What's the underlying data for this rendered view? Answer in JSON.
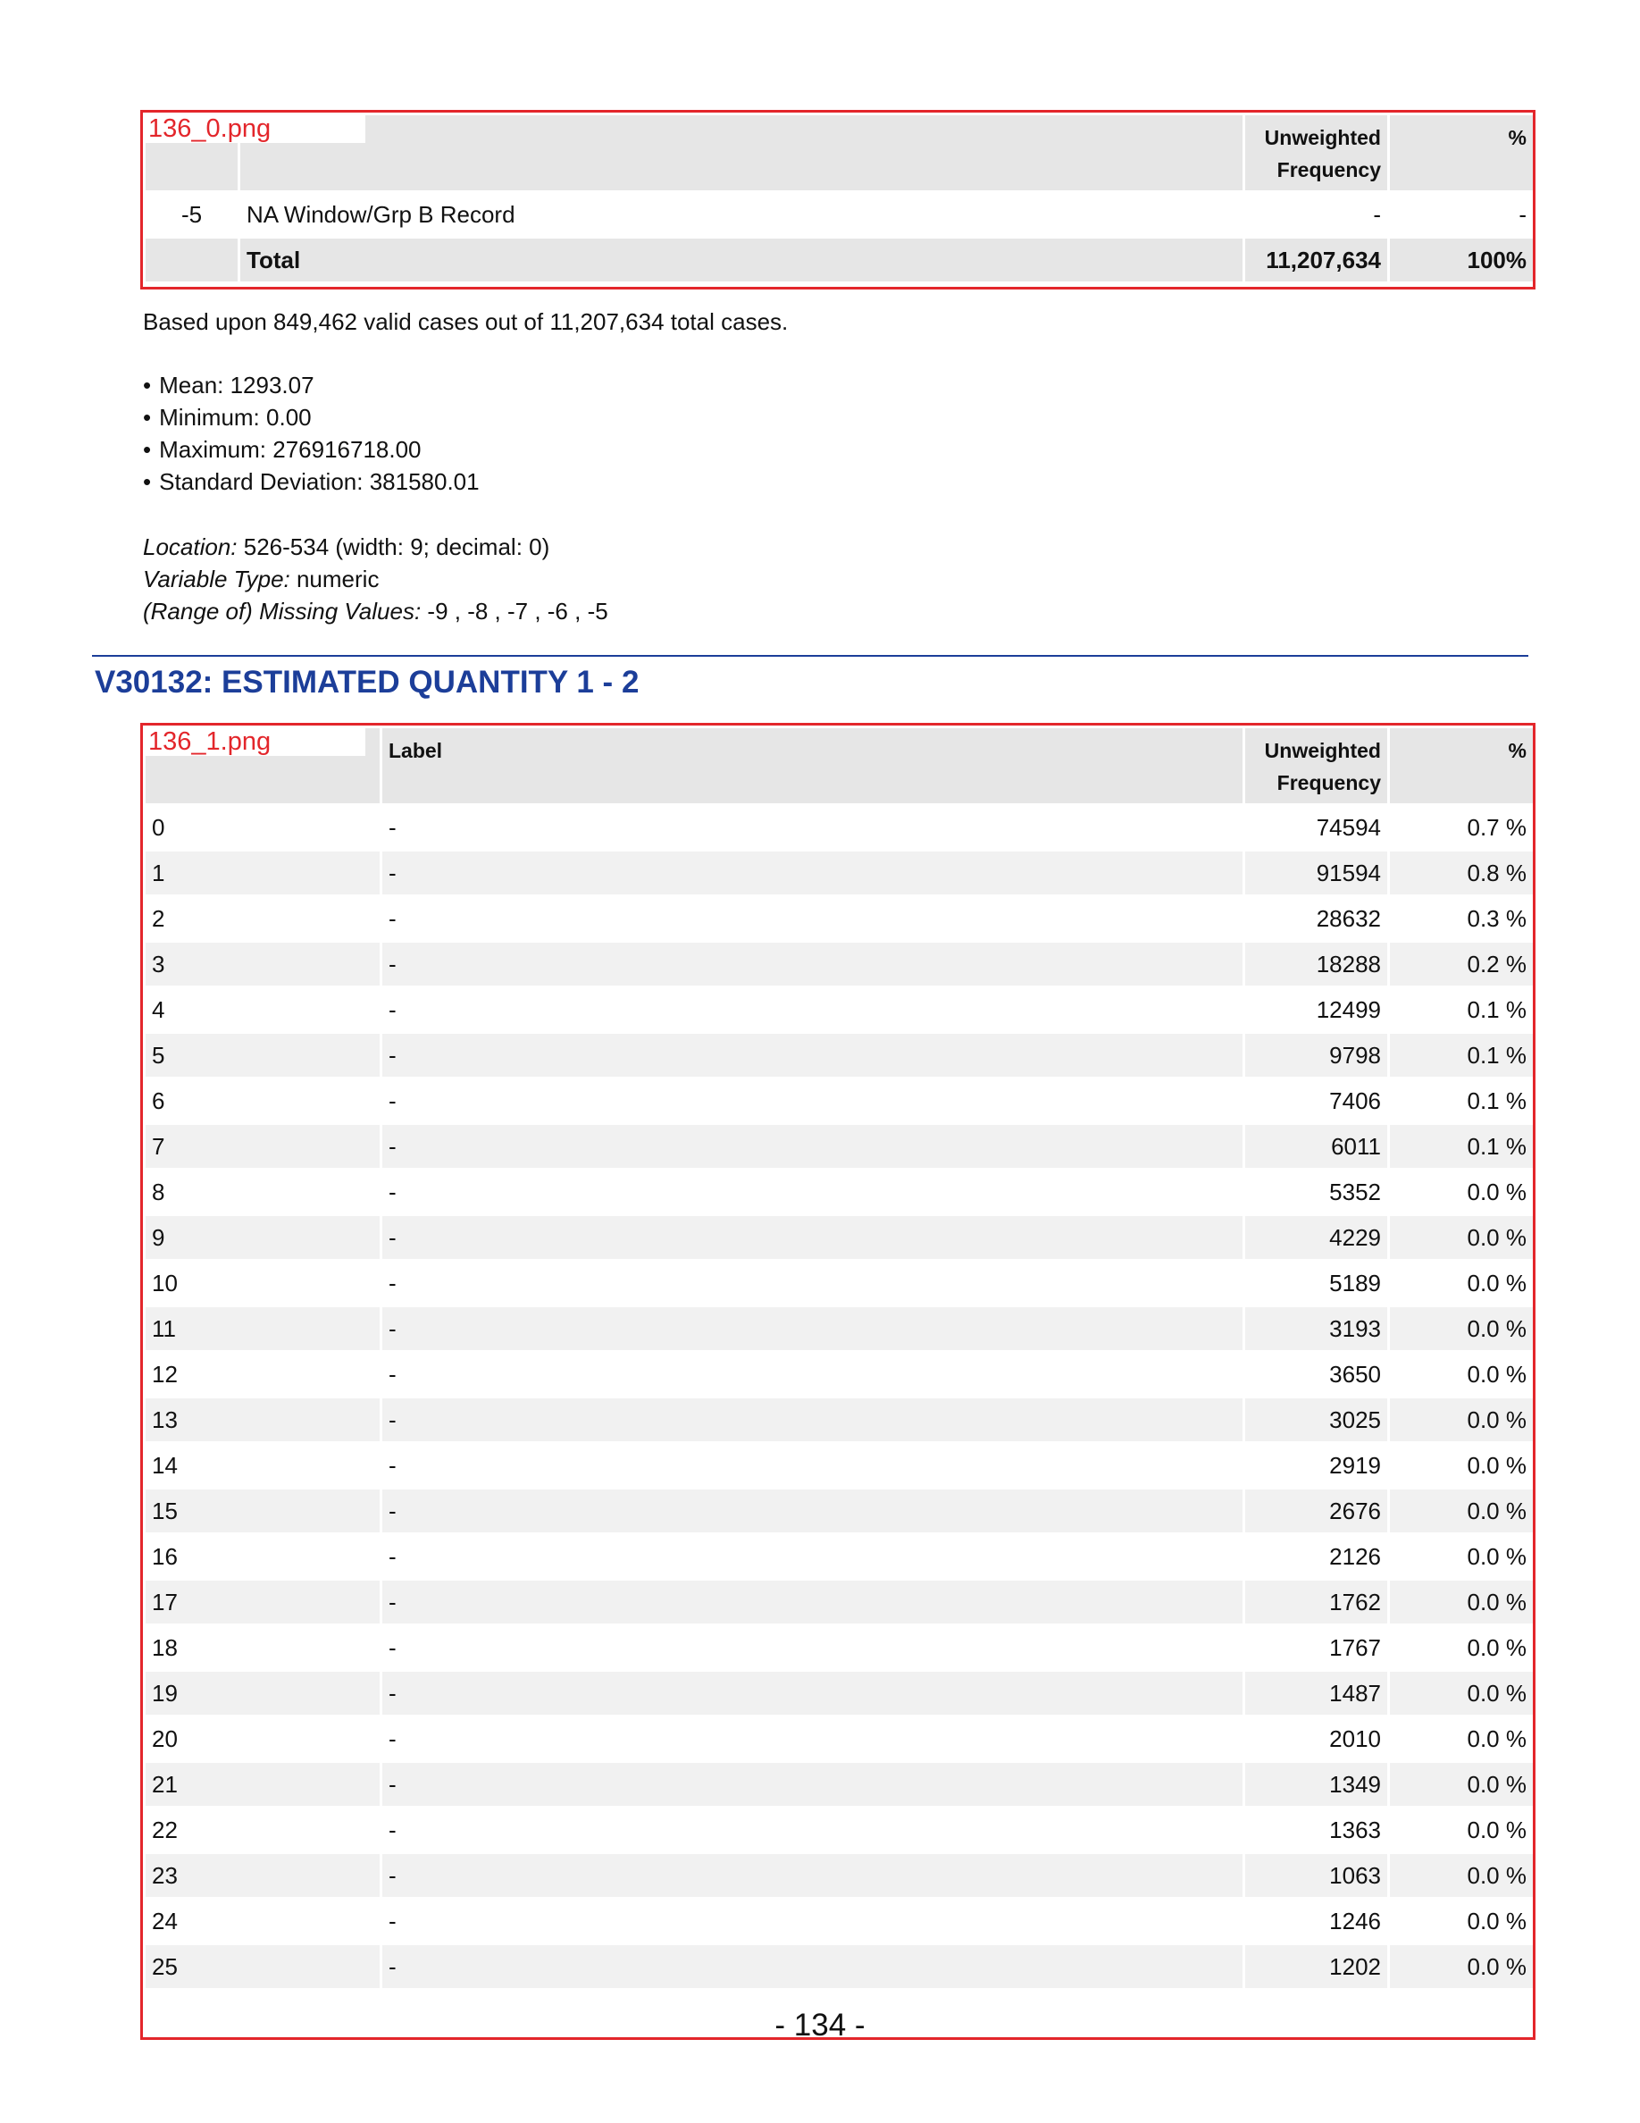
{
  "table1": {
    "tag": "136_0.png",
    "headers": {
      "col1": "",
      "col2": "",
      "freq": "Unweighted Frequency",
      "pct": "%"
    },
    "rows": [
      {
        "code": "-5",
        "label": "NA Window/Grp B Record",
        "freq": "-",
        "pct": "-"
      }
    ],
    "total": {
      "label": "Total",
      "freq": "11,207,634",
      "pct": "100%"
    }
  },
  "summary": {
    "based_on": "Based upon 849,462 valid cases out of 11,207,634 total cases.",
    "stats": [
      "Mean: 1293.07",
      "Minimum: 0.00",
      "Maximum: 276916718.00",
      "Standard Deviation: 381580.01"
    ],
    "location_label": "Location:",
    "location_value": " 526-534 (width: 9; decimal: 0)",
    "vartype_label": "Variable Type:",
    "vartype_value": " numeric",
    "missing_label": "(Range of) Missing Values:",
    "missing_value": " -9 , -8 , -7 , -6 , -5"
  },
  "section": {
    "title": "V30132: ESTIMATED QUANTITY 1 - 2",
    "rule_color": "#1c3e99"
  },
  "table2": {
    "tag": "136_1.png",
    "headers": {
      "value": "",
      "label": "Label",
      "freq": "Unweighted Frequency",
      "pct": "%"
    },
    "rows": [
      {
        "value": "0",
        "label": "-",
        "freq": "74594",
        "pct": "0.7 %"
      },
      {
        "value": "1",
        "label": "-",
        "freq": "91594",
        "pct": "0.8 %"
      },
      {
        "value": "2",
        "label": "-",
        "freq": "28632",
        "pct": "0.3 %"
      },
      {
        "value": "3",
        "label": "-",
        "freq": "18288",
        "pct": "0.2 %"
      },
      {
        "value": "4",
        "label": "-",
        "freq": "12499",
        "pct": "0.1 %"
      },
      {
        "value": "5",
        "label": "-",
        "freq": "9798",
        "pct": "0.1 %"
      },
      {
        "value": "6",
        "label": "-",
        "freq": "7406",
        "pct": "0.1 %"
      },
      {
        "value": "7",
        "label": "-",
        "freq": "6011",
        "pct": "0.1 %"
      },
      {
        "value": "8",
        "label": "-",
        "freq": "5352",
        "pct": "0.0 %"
      },
      {
        "value": "9",
        "label": "-",
        "freq": "4229",
        "pct": "0.0 %"
      },
      {
        "value": "10",
        "label": "-",
        "freq": "5189",
        "pct": "0.0 %"
      },
      {
        "value": "11",
        "label": "-",
        "freq": "3193",
        "pct": "0.0 %"
      },
      {
        "value": "12",
        "label": "-",
        "freq": "3650",
        "pct": "0.0 %"
      },
      {
        "value": "13",
        "label": "-",
        "freq": "3025",
        "pct": "0.0 %"
      },
      {
        "value": "14",
        "label": "-",
        "freq": "2919",
        "pct": "0.0 %"
      },
      {
        "value": "15",
        "label": "-",
        "freq": "2676",
        "pct": "0.0 %"
      },
      {
        "value": "16",
        "label": "-",
        "freq": "2126",
        "pct": "0.0 %"
      },
      {
        "value": "17",
        "label": "-",
        "freq": "1762",
        "pct": "0.0 %"
      },
      {
        "value": "18",
        "label": "-",
        "freq": "1767",
        "pct": "0.0 %"
      },
      {
        "value": "19",
        "label": "-",
        "freq": "1487",
        "pct": "0.0 %"
      },
      {
        "value": "20",
        "label": "-",
        "freq": "2010",
        "pct": "0.0 %"
      },
      {
        "value": "21",
        "label": "-",
        "freq": "1349",
        "pct": "0.0 %"
      },
      {
        "value": "22",
        "label": "-",
        "freq": "1363",
        "pct": "0.0 %"
      },
      {
        "value": "23",
        "label": "-",
        "freq": "1063",
        "pct": "0.0 %"
      },
      {
        "value": "24",
        "label": "-",
        "freq": "1246",
        "pct": "0.0 %"
      },
      {
        "value": "25",
        "label": "-",
        "freq": "1202",
        "pct": "0.0 %"
      }
    ]
  },
  "page_number": "- 134 -",
  "colors": {
    "frame": "#e3262b",
    "header_bg": "#e6e6e6",
    "stripe_bg": "#f1f1f1",
    "title": "#1c3e99"
  }
}
